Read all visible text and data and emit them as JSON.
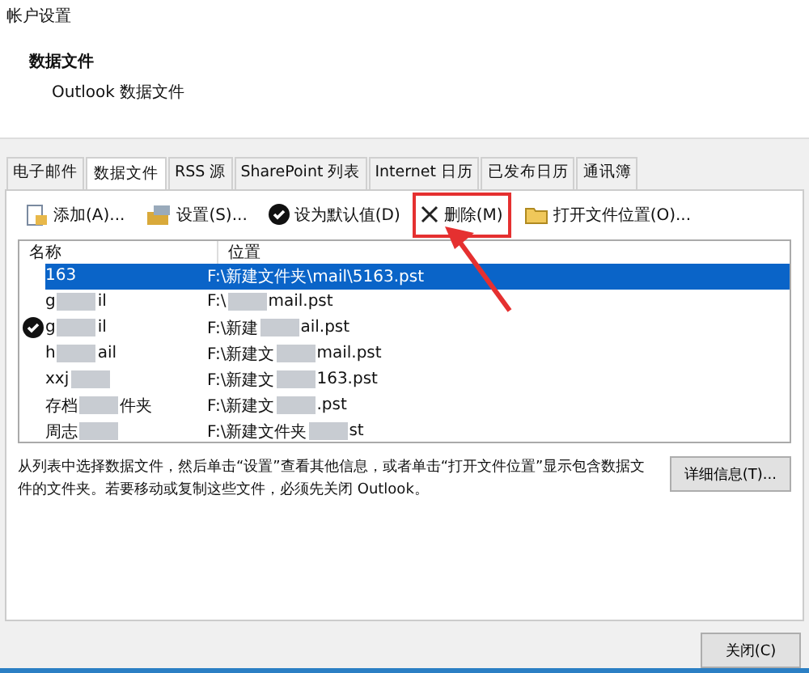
{
  "window": {
    "title": "帐户设置"
  },
  "header": {
    "title": "数据文件",
    "subtitle": "Outlook 数据文件"
  },
  "tabs": [
    {
      "label": "电子邮件",
      "selected": false
    },
    {
      "label": "数据文件",
      "selected": true
    },
    {
      "label": "RSS 源",
      "selected": false
    },
    {
      "label": "SharePoint 列表",
      "selected": false
    },
    {
      "label": "Internet 日历",
      "selected": false
    },
    {
      "label": "已发布日历",
      "selected": false
    },
    {
      "label": "通讯簿",
      "selected": false
    }
  ],
  "toolbar": [
    {
      "kind": "add",
      "label": "添加(A)...",
      "highlighted": false
    },
    {
      "kind": "settings",
      "label": "设置(S)...",
      "highlighted": false
    },
    {
      "kind": "default",
      "label": "设为默认值(D)",
      "highlighted": false
    },
    {
      "kind": "delete",
      "label": "删除(M)",
      "highlighted": true
    },
    {
      "kind": "folder",
      "label": "打开文件位置(O)...",
      "highlighted": false
    }
  ],
  "table": {
    "columns": [
      "名称",
      "位置"
    ],
    "rows": [
      {
        "selected": true,
        "default": false,
        "name": [
          "163"
        ],
        "location": [
          "F:\\新建文件夹\\mail\\5163.pst"
        ]
      },
      {
        "selected": false,
        "default": false,
        "name": [
          "g",
          "il"
        ],
        "location": [
          "F:\\",
          "mail.pst"
        ]
      },
      {
        "selected": false,
        "default": true,
        "name": [
          "g",
          "il"
        ],
        "location": [
          "F:\\新建",
          "ail.pst"
        ]
      },
      {
        "selected": false,
        "default": false,
        "name": [
          "h",
          "ail"
        ],
        "location": [
          "F:\\新建文",
          "mail.pst"
        ]
      },
      {
        "selected": false,
        "default": false,
        "name": [
          "xxj"
        ],
        "location": [
          "F:\\新建文",
          "163.pst"
        ]
      },
      {
        "selected": false,
        "default": false,
        "name": [
          "存档",
          "件夹"
        ],
        "location": [
          "F:\\新建文",
          ".pst"
        ]
      },
      {
        "selected": false,
        "default": false,
        "name": [
          "周志"
        ],
        "location": [
          "F:\\新建文件夹",
          "st"
        ]
      }
    ]
  },
  "description": "从列表中选择数据文件，然后单击“设置”查看其他信息，或者单击“打开文件位置”显示包含数据文件的文件夹。若要移动或复制这些文件，必须先关闭 Outlook。",
  "details_button": "详细信息(T)...",
  "close_button": "关闭(C)"
}
